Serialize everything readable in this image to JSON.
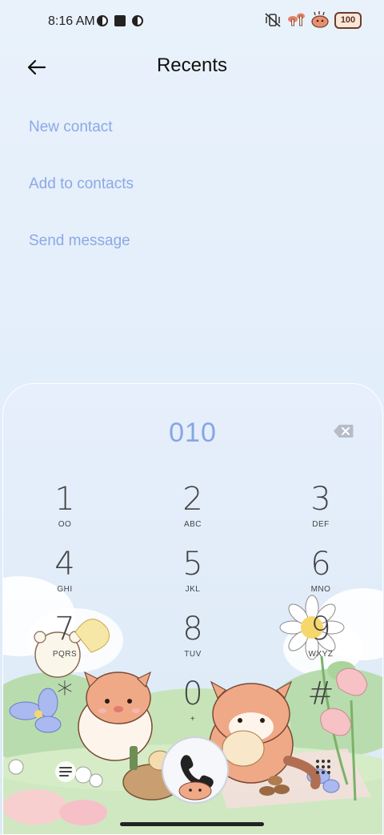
{
  "status": {
    "time": "8:16 AM",
    "battery": "100"
  },
  "header": {
    "title": "Recents"
  },
  "menu": [
    {
      "label": "New contact"
    },
    {
      "label": "Add to contacts"
    },
    {
      "label": "Send message"
    }
  ],
  "dialer": {
    "number": "010",
    "keys": [
      {
        "digit": "1",
        "letters": "OO"
      },
      {
        "digit": "2",
        "letters": "ABC"
      },
      {
        "digit": "3",
        "letters": "DEF"
      },
      {
        "digit": "4",
        "letters": "GHI"
      },
      {
        "digit": "5",
        "letters": "JKL"
      },
      {
        "digit": "6",
        "letters": "MNO"
      },
      {
        "digit": "7",
        "letters": "PQRS"
      },
      {
        "digit": "8",
        "letters": "TUV"
      },
      {
        "digit": "9",
        "letters": "WXYZ"
      },
      {
        "digit": "*",
        "letters": ""
      },
      {
        "digit": "0",
        "letters": "+"
      },
      {
        "digit": "#",
        "letters": ""
      }
    ]
  }
}
